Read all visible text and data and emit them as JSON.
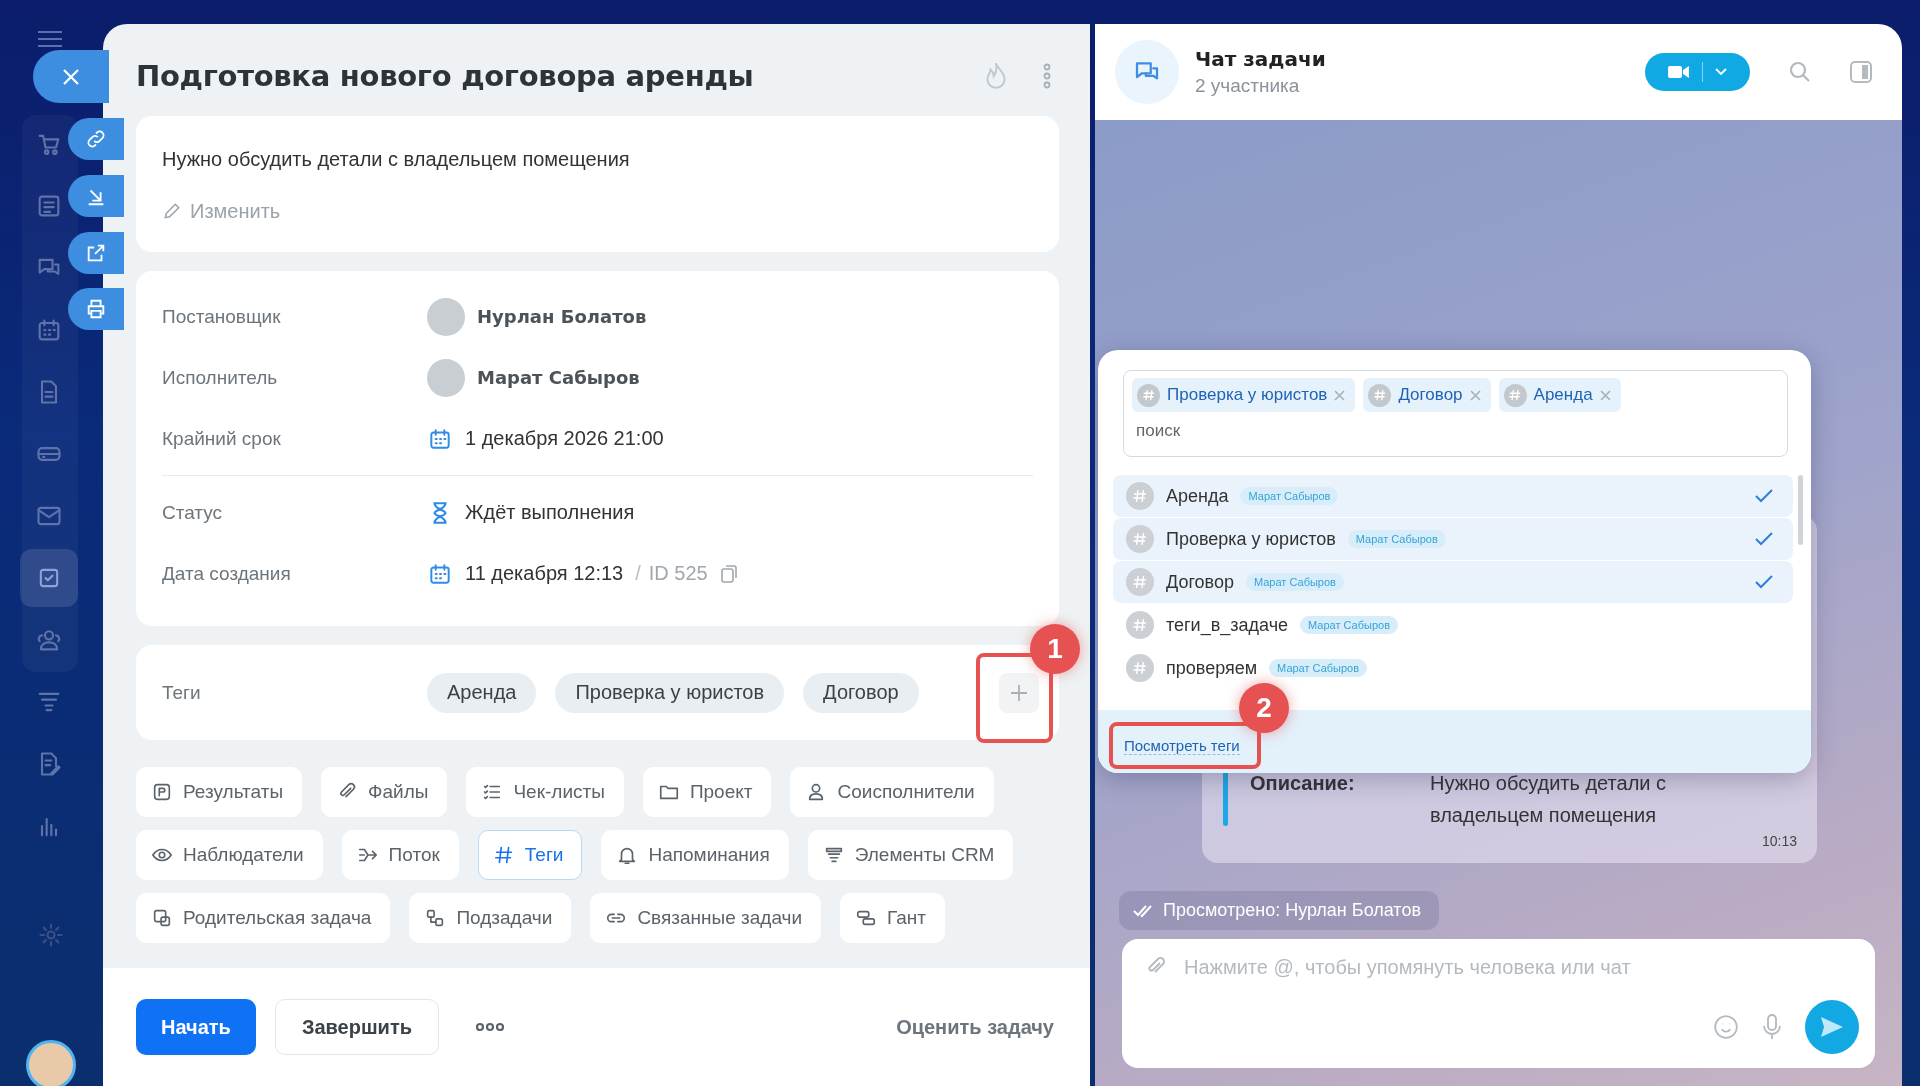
{
  "nav": [
    {
      "kind": "cart",
      "selected": false
    },
    {
      "kind": "news",
      "selected": false
    },
    {
      "kind": "chat",
      "selected": false
    },
    {
      "kind": "calendar",
      "selected": false
    },
    {
      "kind": "doc",
      "selected": false
    },
    {
      "kind": "drive",
      "selected": false
    },
    {
      "kind": "mail",
      "selected": false
    },
    {
      "kind": "tasks",
      "selected": true
    },
    {
      "kind": "people",
      "selected": false
    },
    {
      "kind": "funnel",
      "selected": false
    },
    {
      "kind": "sign",
      "selected": false
    },
    {
      "kind": "chart",
      "selected": false
    }
  ],
  "task": {
    "title": "Подготовка нового договора аренды",
    "description": "Нужно обсудить детали с владельцем помещения",
    "edit_link": "Изменить",
    "fields": [
      {
        "kind": "person",
        "label": "Постановщик",
        "value": "Нурлан Болатов"
      },
      {
        "kind": "person",
        "label": "Исполнитель",
        "value": "Марат Сабыров"
      },
      {
        "kind": "date",
        "label": "Крайний срок",
        "value": "1 декабря 2026 21:00"
      },
      {
        "kind": "status",
        "label": "Статус",
        "value": "Ждёт выполнения"
      },
      {
        "kind": "created",
        "label": "Дата создания",
        "value": "11 декабря 12:13",
        "separator": "/",
        "id": "ID 525"
      }
    ],
    "tags": {
      "label": "Теги",
      "items": [
        "Аренда",
        "Проверка у юристов",
        "Договор"
      ]
    },
    "sections": [
      {
        "kind": "results",
        "label": "Результаты",
        "selected": false
      },
      {
        "kind": "files",
        "label": "Файлы",
        "selected": false
      },
      {
        "kind": "checklist",
        "label": "Чек-листы",
        "selected": false
      },
      {
        "kind": "folder",
        "label": "Проект",
        "selected": false
      },
      {
        "kind": "person",
        "label": "Соисполнители",
        "selected": false
      },
      {
        "kind": "eye",
        "label": "Наблюдатели",
        "selected": false
      },
      {
        "kind": "flow",
        "label": "Поток",
        "selected": false
      },
      {
        "kind": "hash",
        "label": "Теги",
        "selected": true
      },
      {
        "kind": "bell",
        "label": "Напоминания",
        "selected": false
      },
      {
        "kind": "crm",
        "label": "Элементы CRM",
        "selected": false
      },
      {
        "kind": "parent",
        "label": "Родительская задача",
        "selected": false
      },
      {
        "kind": "subtasks",
        "label": "Подзадачи",
        "selected": false
      },
      {
        "kind": "link",
        "label": "Связанные задачи",
        "selected": false
      },
      {
        "kind": "gantt",
        "label": "Гант",
        "selected": false
      }
    ],
    "start_button": "Начать",
    "finish_button": "Завершить",
    "rate_link": "Оценить задачу"
  },
  "chat": {
    "title": "Чат задачи",
    "subtitle": "2 участника",
    "message": {
      "label": "Описание:",
      "text": "Нужно обсудить детали с владельцем помещения",
      "time": "10:13"
    },
    "seen": "Просмотрено: Нурлан Болатов",
    "input": {
      "placeholder": "Нажмите @, чтобы упомянуть человека или чат"
    }
  },
  "tag_popup": {
    "chosen": [
      "Проверка у юристов",
      "Договор",
      "Аренда"
    ],
    "search": {
      "placeholder": "поиск"
    },
    "tags": [
      {
        "name": "Аренда",
        "author": "Марат Сабыров",
        "selected": true
      },
      {
        "name": "Проверка у юристов",
        "author": "Марат Сабыров",
        "selected": true
      },
      {
        "name": "Договор",
        "author": "Марат Сабыров",
        "selected": true
      },
      {
        "name": "теги_в_задаче",
        "author": "Марат Сабыров",
        "selected": false
      },
      {
        "name": "проверяем",
        "author": "Марат Сабыров",
        "selected": false
      }
    ],
    "footer_link": "Посмотреть теги"
  },
  "annotations": [
    {
      "label": "1"
    },
    {
      "label": "2"
    }
  ]
}
